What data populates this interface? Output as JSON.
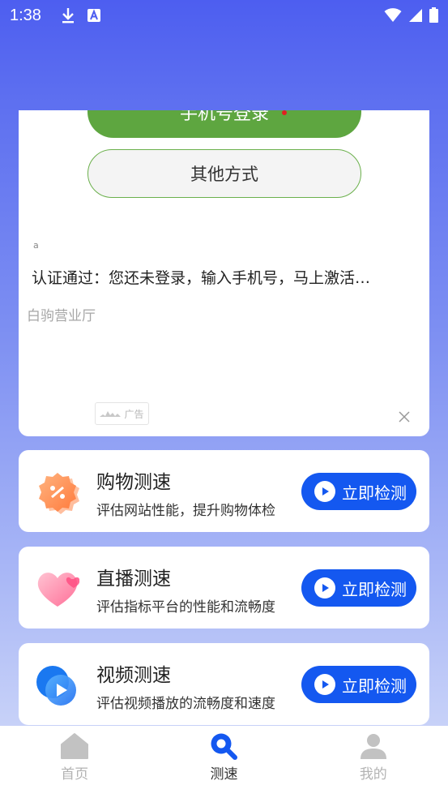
{
  "status_bar": {
    "time": "1:38"
  },
  "ad": {
    "phone_login_label": "手机号登录",
    "other_login_label": "其他方式",
    "small_mark": "a",
    "title": "认证通过：您还未登录，输入手机号，马上激活…",
    "source": "白驹营业厅",
    "badge_label": "广告"
  },
  "speed_tests": [
    {
      "title": "购物测速",
      "description": "评估网站性能，提升购物体检",
      "button": "立即检测",
      "icon": "shopping-badge-icon"
    },
    {
      "title": "直播测速",
      "description": "评估指标平台的性能和流畅度",
      "button": "立即检测",
      "icon": "heart-icon"
    },
    {
      "title": "视频测速",
      "description": "评估视频播放的流畅度和速度",
      "button": "立即检测",
      "icon": "video-play-icon"
    }
  ],
  "bottom_nav": {
    "items": [
      {
        "label": "首页",
        "icon": "home-icon",
        "active": false
      },
      {
        "label": "测速",
        "icon": "search-icon",
        "active": true
      },
      {
        "label": "我的",
        "icon": "user-icon",
        "active": false
      }
    ]
  },
  "colors": {
    "primary": "#1458f0",
    "login_green": "#5ea640"
  }
}
